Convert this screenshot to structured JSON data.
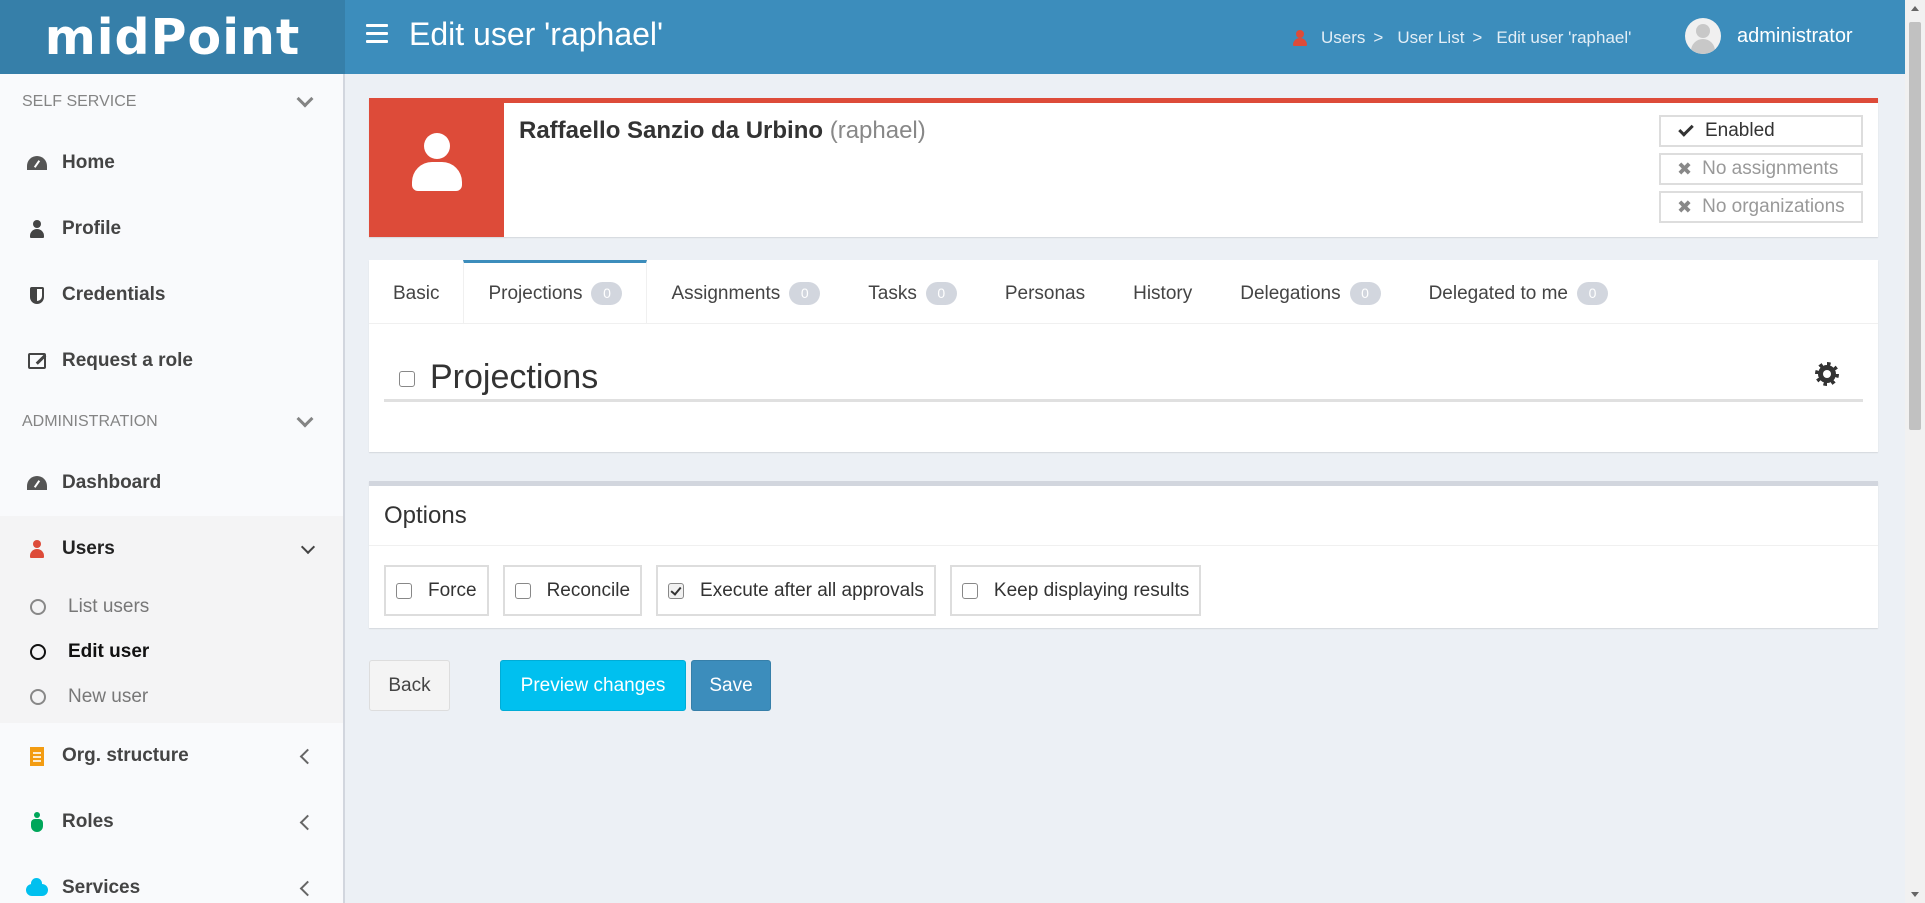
{
  "header": {
    "logo": "midPoint",
    "title": "Edit user 'raphael'",
    "breadcrumb": [
      "Users",
      "User List",
      "Edit user 'raphael'"
    ],
    "breadcrumb_sep": ">",
    "username": "administrator",
    "color": "#3c8dbc"
  },
  "sidebar": {
    "self_service": "SELF SERVICE",
    "self_items": [
      {
        "label": "Home",
        "icon": "dashboard-icon"
      },
      {
        "label": "Profile",
        "icon": "user-icon"
      },
      {
        "label": "Credentials",
        "icon": "shield-icon"
      },
      {
        "label": "Request a role",
        "icon": "edit-icon"
      }
    ],
    "administration": "ADMINISTRATION",
    "admin_items": {
      "dashboard": "Dashboard",
      "users": "Users",
      "users_sub": [
        "List users",
        "Edit user",
        "New user"
      ],
      "org": "Org. structure",
      "roles": "Roles",
      "services": "Services"
    }
  },
  "user": {
    "full_name": "Raffaello Sanzio da Urbino",
    "username": "(raphael)",
    "status": [
      "Enabled",
      "No assignments",
      "No organizations"
    ],
    "accent": "#dd4b39"
  },
  "tabs": [
    {
      "label": "Basic"
    },
    {
      "label": "Projections",
      "count": "0",
      "active": true
    },
    {
      "label": "Assignments",
      "count": "0"
    },
    {
      "label": "Tasks",
      "count": "0"
    },
    {
      "label": "Personas"
    },
    {
      "label": "History"
    },
    {
      "label": "Delegations",
      "count": "0"
    },
    {
      "label": "Delegated to me",
      "count": "0"
    }
  ],
  "projections": {
    "title": "Projections"
  },
  "options": {
    "title": "Options",
    "items": [
      {
        "label": "Force",
        "checked": false
      },
      {
        "label": "Reconcile",
        "checked": false
      },
      {
        "label": "Execute after all approvals",
        "checked": true
      },
      {
        "label": "Keep displaying results",
        "checked": false
      }
    ]
  },
  "buttons": {
    "back": "Back",
    "preview": "Preview changes",
    "save": "Save"
  }
}
